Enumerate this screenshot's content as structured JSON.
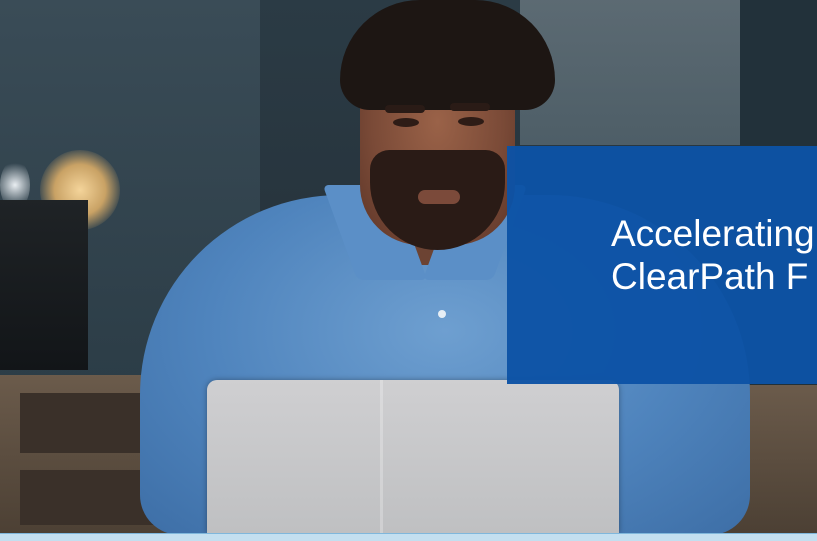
{
  "hero": {
    "title_line_1": "Accelerating",
    "title_line_2": "ClearPath F",
    "panel_color": "#0d52a6",
    "bottom_bar_color": "#c3dff0"
  }
}
